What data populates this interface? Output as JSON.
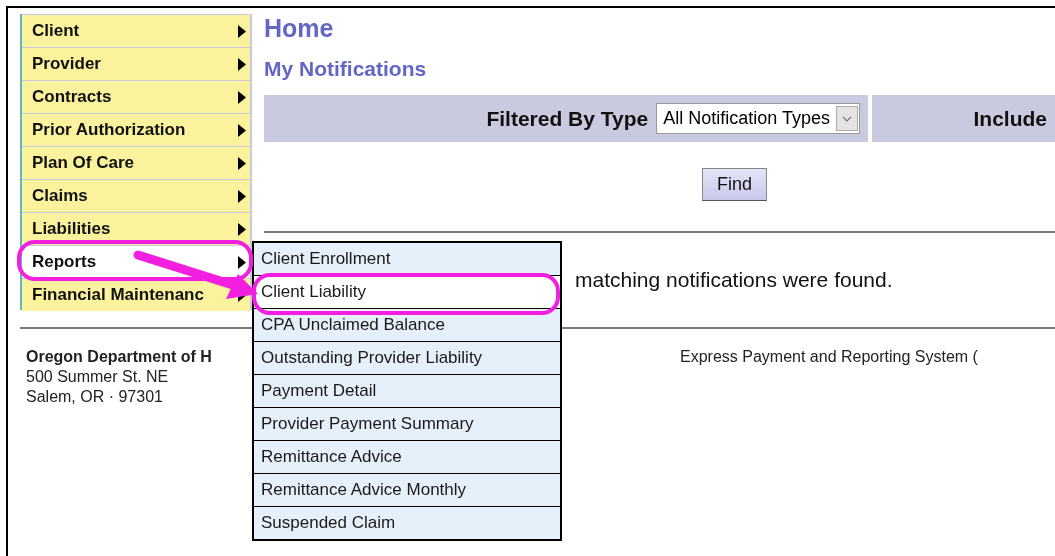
{
  "sidebar": {
    "items": [
      {
        "label": "Client",
        "selected": false
      },
      {
        "label": "Provider",
        "selected": false
      },
      {
        "label": "Contracts",
        "selected": false
      },
      {
        "label": "Prior Authorization",
        "selected": false
      },
      {
        "label": "Plan Of Care",
        "selected": false
      },
      {
        "label": "Claims",
        "selected": false
      },
      {
        "label": "Liabilities",
        "selected": false
      },
      {
        "label": "Reports",
        "selected": true
      },
      {
        "label": "Financial Maintenanc",
        "selected": false
      }
    ]
  },
  "page": {
    "title": "Home",
    "subtitle": "My Notifications"
  },
  "filter": {
    "label": "Filtered By Type",
    "select_value": "All Notification Types",
    "column_2_label": "Include"
  },
  "find_button": "Find",
  "message": "matching notifications were found.",
  "footer": {
    "organization": "Oregon Department of H",
    "address_lines": [
      "500 Summer St. NE",
      "Salem, OR · 97301"
    ],
    "system_name": "Express Payment and Reporting System ("
  },
  "submenu": {
    "items": [
      {
        "label": "Client Enrollment",
        "selected": false
      },
      {
        "label": "Client Liability",
        "selected": true
      },
      {
        "label": "CPA Unclaimed Balance",
        "selected": false
      },
      {
        "label": "Outstanding Provider Liability",
        "selected": false
      },
      {
        "label": "Payment Detail",
        "selected": false
      },
      {
        "label": "Provider Payment Summary",
        "selected": false
      },
      {
        "label": "Remittance Advice",
        "selected": false
      },
      {
        "label": "Remittance Advice Monthly",
        "selected": false
      },
      {
        "label": "Suspended Claim",
        "selected": false
      }
    ]
  }
}
